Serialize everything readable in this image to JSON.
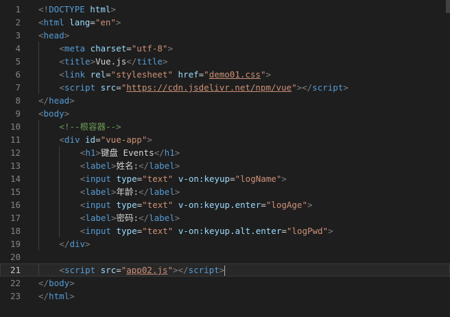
{
  "editor": {
    "active_line": 21,
    "lines": [
      {
        "n": "1",
        "indent": 0,
        "tokens": [
          [
            "ang",
            "<!"
          ],
          [
            "tag",
            "DOCTYPE"
          ],
          [
            "txt",
            " "
          ],
          [
            "attr",
            "html"
          ],
          [
            "ang",
            ">"
          ]
        ]
      },
      {
        "n": "2",
        "indent": 0,
        "tokens": [
          [
            "ang",
            "<"
          ],
          [
            "tag",
            "html"
          ],
          [
            "txt",
            " "
          ],
          [
            "attr",
            "lang"
          ],
          [
            "txt",
            "="
          ],
          [
            "str",
            "\"en\""
          ],
          [
            "ang",
            ">"
          ]
        ]
      },
      {
        "n": "3",
        "indent": 0,
        "tokens": [
          [
            "ang",
            "<"
          ],
          [
            "tag",
            "head"
          ],
          [
            "ang",
            ">"
          ]
        ]
      },
      {
        "n": "4",
        "indent": 1,
        "tokens": [
          [
            "ang",
            "<"
          ],
          [
            "tag",
            "meta"
          ],
          [
            "txt",
            " "
          ],
          [
            "attr",
            "charset"
          ],
          [
            "txt",
            "="
          ],
          [
            "str",
            "\"utf-8\""
          ],
          [
            "ang",
            ">"
          ]
        ]
      },
      {
        "n": "5",
        "indent": 1,
        "tokens": [
          [
            "ang",
            "<"
          ],
          [
            "tag",
            "title"
          ],
          [
            "ang",
            ">"
          ],
          [
            "txt",
            "Vue.js"
          ],
          [
            "ang",
            "</"
          ],
          [
            "tag",
            "title"
          ],
          [
            "ang",
            ">"
          ]
        ]
      },
      {
        "n": "6",
        "indent": 1,
        "tokens": [
          [
            "ang",
            "<"
          ],
          [
            "tag",
            "link"
          ],
          [
            "txt",
            " "
          ],
          [
            "attr",
            "rel"
          ],
          [
            "txt",
            "="
          ],
          [
            "str",
            "\"stylesheet\""
          ],
          [
            "txt",
            " "
          ],
          [
            "attr",
            "href"
          ],
          [
            "txt",
            "="
          ],
          [
            "str",
            "\""
          ],
          [
            "str link",
            "demo01.css"
          ],
          [
            "str",
            "\""
          ],
          [
            "ang",
            ">"
          ]
        ]
      },
      {
        "n": "7",
        "indent": 1,
        "tokens": [
          [
            "ang",
            "<"
          ],
          [
            "tag",
            "script"
          ],
          [
            "txt",
            " "
          ],
          [
            "attr",
            "src"
          ],
          [
            "txt",
            "="
          ],
          [
            "str",
            "\""
          ],
          [
            "str link",
            "https://cdn.jsdelivr.net/npm/vue"
          ],
          [
            "str",
            "\""
          ],
          [
            "ang",
            "></"
          ],
          [
            "tag",
            "script"
          ],
          [
            "ang",
            ">"
          ]
        ]
      },
      {
        "n": "8",
        "indent": 0,
        "tokens": [
          [
            "ang",
            "</"
          ],
          [
            "tag",
            "head"
          ],
          [
            "ang",
            ">"
          ]
        ]
      },
      {
        "n": "9",
        "indent": 0,
        "tokens": [
          [
            "ang",
            "<"
          ],
          [
            "tag",
            "body"
          ],
          [
            "ang",
            ">"
          ]
        ]
      },
      {
        "n": "10",
        "indent": 1,
        "tokens": [
          [
            "cmt",
            "<!--根容器-->"
          ]
        ]
      },
      {
        "n": "11",
        "indent": 1,
        "tokens": [
          [
            "ang",
            "<"
          ],
          [
            "tag",
            "div"
          ],
          [
            "txt",
            " "
          ],
          [
            "attr",
            "id"
          ],
          [
            "txt",
            "="
          ],
          [
            "str",
            "\"vue-app\""
          ],
          [
            "ang",
            ">"
          ]
        ]
      },
      {
        "n": "12",
        "indent": 2,
        "tokens": [
          [
            "ang",
            "<"
          ],
          [
            "tag",
            "h1"
          ],
          [
            "ang",
            ">"
          ],
          [
            "txt",
            "键盘 Events"
          ],
          [
            "ang",
            "</"
          ],
          [
            "tag",
            "h1"
          ],
          [
            "ang",
            ">"
          ]
        ]
      },
      {
        "n": "13",
        "indent": 2,
        "tokens": [
          [
            "ang",
            "<"
          ],
          [
            "tag",
            "label"
          ],
          [
            "ang",
            ">"
          ],
          [
            "txt",
            "姓名:"
          ],
          [
            "ang",
            "</"
          ],
          [
            "tag",
            "label"
          ],
          [
            "ang",
            ">"
          ]
        ]
      },
      {
        "n": "14",
        "indent": 2,
        "tokens": [
          [
            "ang",
            "<"
          ],
          [
            "tag",
            "input"
          ],
          [
            "txt",
            " "
          ],
          [
            "attr",
            "type"
          ],
          [
            "txt",
            "="
          ],
          [
            "str",
            "\"text\""
          ],
          [
            "txt",
            " "
          ],
          [
            "attr",
            "v-on:keyup"
          ],
          [
            "txt",
            "="
          ],
          [
            "str",
            "\"logName\""
          ],
          [
            "ang",
            ">"
          ]
        ]
      },
      {
        "n": "15",
        "indent": 2,
        "tokens": [
          [
            "ang",
            "<"
          ],
          [
            "tag",
            "label"
          ],
          [
            "ang",
            ">"
          ],
          [
            "txt",
            "年龄:"
          ],
          [
            "ang",
            "</"
          ],
          [
            "tag",
            "label"
          ],
          [
            "ang",
            ">"
          ]
        ]
      },
      {
        "n": "16",
        "indent": 2,
        "tokens": [
          [
            "ang",
            "<"
          ],
          [
            "tag",
            "input"
          ],
          [
            "txt",
            " "
          ],
          [
            "attr",
            "type"
          ],
          [
            "txt",
            "="
          ],
          [
            "str",
            "\"text\""
          ],
          [
            "txt",
            " "
          ],
          [
            "attr",
            "v-on:keyup.enter"
          ],
          [
            "txt",
            "="
          ],
          [
            "str",
            "\"logAge\""
          ],
          [
            "ang",
            ">"
          ]
        ]
      },
      {
        "n": "17",
        "indent": 2,
        "tokens": [
          [
            "ang",
            "<"
          ],
          [
            "tag",
            "label"
          ],
          [
            "ang",
            ">"
          ],
          [
            "txt",
            "密码:"
          ],
          [
            "ang",
            "</"
          ],
          [
            "tag",
            "label"
          ],
          [
            "ang",
            ">"
          ]
        ]
      },
      {
        "n": "18",
        "indent": 2,
        "tokens": [
          [
            "ang",
            "<"
          ],
          [
            "tag",
            "input"
          ],
          [
            "txt",
            " "
          ],
          [
            "attr",
            "type"
          ],
          [
            "txt",
            "="
          ],
          [
            "str",
            "\"text\""
          ],
          [
            "txt",
            " "
          ],
          [
            "attr",
            "v-on:keyup.alt.enter"
          ],
          [
            "txt",
            "="
          ],
          [
            "str",
            "\"logPwd\""
          ],
          [
            "ang",
            ">"
          ]
        ]
      },
      {
        "n": "19",
        "indent": 1,
        "tokens": [
          [
            "ang",
            "</"
          ],
          [
            "tag",
            "div"
          ],
          [
            "ang",
            ">"
          ]
        ]
      },
      {
        "n": "20",
        "indent": 0,
        "tokens": []
      },
      {
        "n": "21",
        "indent": 1,
        "tokens": [
          [
            "ang",
            "<"
          ],
          [
            "tag",
            "script"
          ],
          [
            "txt",
            " "
          ],
          [
            "attr",
            "src"
          ],
          [
            "txt",
            "="
          ],
          [
            "str",
            "\""
          ],
          [
            "str link",
            "app02.js"
          ],
          [
            "str",
            "\""
          ],
          [
            "ang",
            "></"
          ],
          [
            "tag",
            "script"
          ],
          [
            "ang",
            ">"
          ]
        ]
      },
      {
        "n": "22",
        "indent": 0,
        "tokens": [
          [
            "ang",
            "</"
          ],
          [
            "tag",
            "body"
          ],
          [
            "ang",
            ">"
          ]
        ]
      },
      {
        "n": "23",
        "indent": 0,
        "tokens": [
          [
            "ang",
            "</"
          ],
          [
            "tag",
            "html"
          ],
          [
            "ang",
            ">"
          ]
        ]
      }
    ]
  }
}
